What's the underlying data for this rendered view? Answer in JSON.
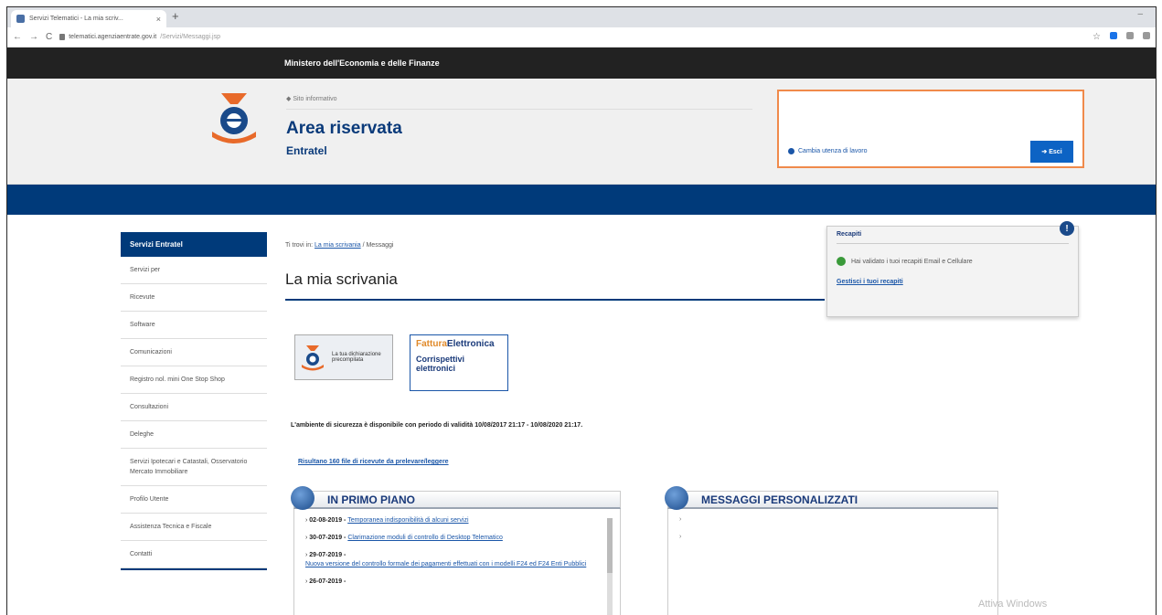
{
  "browser": {
    "tab_title": "Servizi Telematici - La mia scriv...",
    "url_domain": "telematici.agenziaentrate.gov.it",
    "url_path": "/Servizi/Messaggi.jsp"
  },
  "ministry": {
    "label": "Ministero dell'Economia e delle Finanze"
  },
  "header": {
    "site_info": "Sito informativo",
    "title": "Area riservata",
    "subtitle": "Entratel",
    "change_context": "Cambia utenza di lavoro",
    "exit_label": "Esci"
  },
  "sidebar": {
    "head": "Servizi Entratel",
    "items": [
      {
        "label": "Servizi per"
      },
      {
        "label": "Ricevute"
      },
      {
        "label": "Software"
      },
      {
        "label": "Comunicazioni"
      },
      {
        "label": "Registro nol. mini One Stop Shop"
      },
      {
        "label": "Consultazioni"
      },
      {
        "label": "Deleghe"
      },
      {
        "label": "Servizi Ipotecari e Catastali, Osservatorio Mercato Immobiliare"
      },
      {
        "label": "Profilo Utente"
      },
      {
        "label": "Assistenza Tecnica e Fiscale"
      },
      {
        "label": "Contatti"
      }
    ]
  },
  "breadcrumb": {
    "prefix": "Ti trovi in:",
    "link": "La mia scrivania",
    "sep": "/",
    "current": "Messaggi"
  },
  "page_title": "La mia scrivania",
  "banners": {
    "b1_text": "La tua dichiarazione precompilata",
    "b2_line1_a": "Fattura",
    "b2_line1_b": "Elettronica",
    "b2_line2": "Corrispettivi elettronici"
  },
  "notice": "L'ambiente di sicurezza è disponibile con periodo di validità 10/08/2017 21:17 - 10/08/2020 21:17.",
  "results_link": "Risultano 160 file di ricevute da prelevare/leggere",
  "primo_piano": {
    "title": "IN PRIMO PIANO",
    "items": [
      {
        "date": "02-08-2019 -",
        "text": "Temporanea indisponibilità di alcuni servizi"
      },
      {
        "date": "30-07-2019 -",
        "text": "Clarimazione moduli di controllo di Desktop Telematico"
      },
      {
        "date": "29-07-2019 -",
        "text": "Nuova versione del controllo formale dei pagamenti effettuati con i modelli F24 ed F24 Enti Pubblici"
      },
      {
        "date": "26-07-2019 -",
        "text": ""
      }
    ]
  },
  "messaggi": {
    "title": "MESSAGGI PERSONALIZZATI"
  },
  "recapiti": {
    "title": "Recapiti",
    "message": "Hai validato i tuoi recapiti Email e Cellulare",
    "link": "Gestisci i tuoi recapiti"
  },
  "watermark": "Attiva Windows"
}
